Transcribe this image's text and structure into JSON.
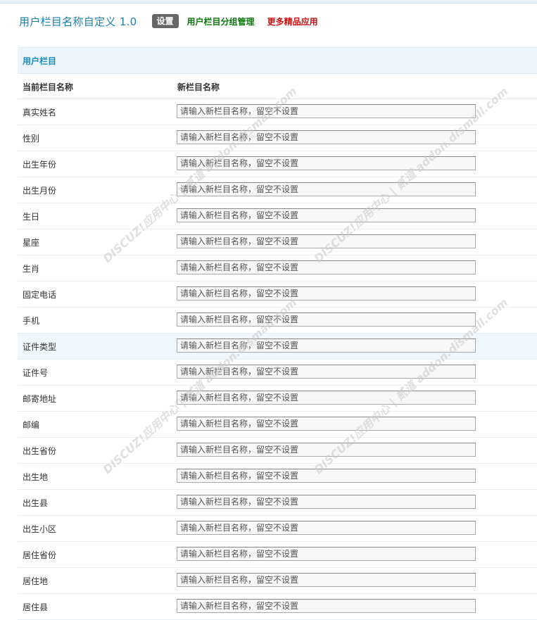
{
  "header": {
    "title": "用户栏目名称自定义 1.0",
    "settings_button": "设置",
    "group_link": "用户栏目分组管理",
    "more_link": "更多精品应用"
  },
  "section": {
    "title": "用户栏目"
  },
  "columns": {
    "current": "当前栏目名称",
    "new": "新栏目名称"
  },
  "input_placeholder": "请输入新栏目名称，留空不设置",
  "rows": [
    {
      "label": "真实姓名"
    },
    {
      "label": "性别"
    },
    {
      "label": "出生年份"
    },
    {
      "label": "出生月份"
    },
    {
      "label": "生日"
    },
    {
      "label": "星座"
    },
    {
      "label": "生肖"
    },
    {
      "label": "固定电话"
    },
    {
      "label": "手机"
    },
    {
      "label": "证件类型"
    },
    {
      "label": "证件号"
    },
    {
      "label": "邮寄地址"
    },
    {
      "label": "邮编"
    },
    {
      "label": "出生省份"
    },
    {
      "label": "出生地"
    },
    {
      "label": "出生县"
    },
    {
      "label": "出生小区"
    },
    {
      "label": "居住省份"
    },
    {
      "label": "居住地"
    },
    {
      "label": "居住县"
    }
  ],
  "watermark": "DISCUZ!应用中心 | 贰道 addon.dismall.com"
}
